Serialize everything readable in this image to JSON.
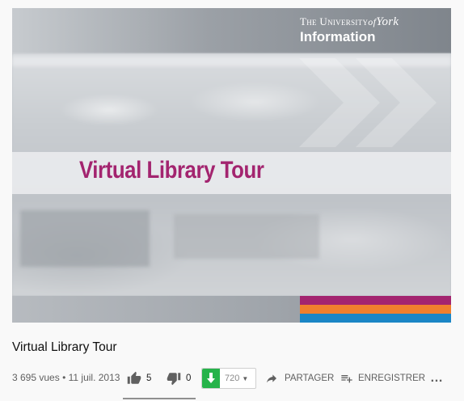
{
  "video": {
    "overlay_title": "Virtual Library Tour",
    "logo": {
      "line1_part1": "The University",
      "line1_of": "of",
      "line1_part2": "York",
      "line2": "Information"
    },
    "stripe_colors": [
      "#a3246f",
      "#f07f2d",
      "#1b86c6"
    ]
  },
  "info": {
    "title": "Virtual Library Tour",
    "views": "3 695 vues",
    "separator": "•",
    "date": "11 juil. 2013"
  },
  "actions": {
    "like_count": "5",
    "dislike_count": "0",
    "download_count": "720",
    "share_label": "PARTAGER",
    "save_label": "ENREGISTRER"
  },
  "icons": [
    "thumbs-up-icon",
    "thumbs-down-icon",
    "download-icon",
    "share-arrow-icon",
    "add-to-playlist-icon",
    "more-icon"
  ]
}
